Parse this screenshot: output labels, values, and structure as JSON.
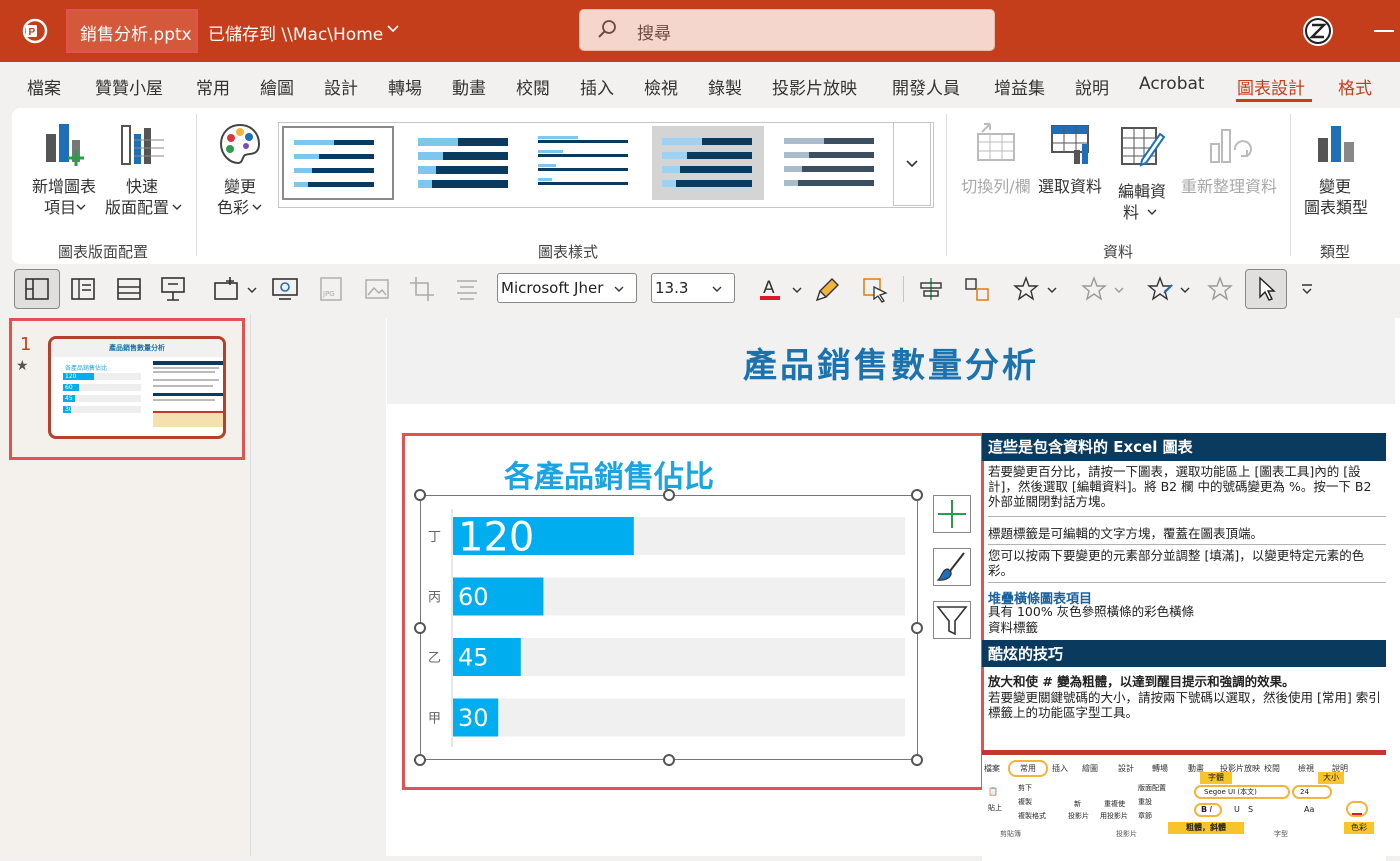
{
  "titlebar": {
    "filename": "銷售分析.pptx",
    "save_status": "已儲存到 \\\\Mac\\Home",
    "search_placeholder": "搜尋"
  },
  "tabs": [
    "檔案",
    "贊贊小屋",
    "常用",
    "繪圖",
    "設計",
    "轉場",
    "動畫",
    "校閱",
    "插入",
    "檢視",
    "錄製",
    "投影片放映",
    "開發人員",
    "增益集",
    "說明",
    "Acrobat",
    "圖表設計",
    "格式"
  ],
  "active_tab": "圖表設計",
  "ribbon": {
    "add_element_1": "新增圖表",
    "add_element_2": "項目",
    "quick_layout_1": "快速",
    "quick_layout_2": "版面配置",
    "group_layouts": "圖表版面配置",
    "change_colors_1": "變更",
    "change_colors_2": "色彩",
    "group_styles": "圖表樣式",
    "switch_row_col": "切換列/欄",
    "select_data": "選取資料",
    "edit_data_1": "編輯資",
    "edit_data_2": "料",
    "refresh_data": "重新整理資料",
    "group_data": "資料",
    "change_type_1": "變更",
    "change_type_2": "圖表類型",
    "group_type": "類型"
  },
  "toolbar": {
    "font_name": "Microsoft Jher",
    "font_size": "13.3"
  },
  "thumbnails": {
    "slide_number": "1",
    "star": "★",
    "title": "產品銷售數量分析",
    "chart_title": "各產品銷售佔比"
  },
  "slide": {
    "title": "產品銷售數量分析",
    "info_header_1": "這些是包含資料的 Excel 圖表",
    "info_p1": "若要變更百分比，請按一下圖表，選取功能區上 [圖表工具]內的 [設計]，然後選取 [編輯資料]。將 B2 欄 中的號碼變更為 %。按一下 B2 外部並關閉對話方塊。",
    "info_p2": "標題標籤是可編輯的文字方塊，覆蓋在圖表頂端。",
    "info_p3": "您可以按兩下要變更的元素部分並調整 [填滿]，以變更特定元素的色彩。",
    "info_sub": "堆疊橫條圖表項目",
    "info_p4a": "具有 100% 灰色參照橫條的彩色橫條",
    "info_p4b": "資料標籤",
    "info_header_2": "酷炫的技巧",
    "info_p5": "放大和使 # 變為粗體，以達到醒目提示和強調的效果。",
    "info_p6": "若要變更關鍵號碼的大小，請按兩下號碼以選取，然後使用 [常用] 索引標籤上的功能區字型工具。",
    "embed": {
      "tabs": [
        "檔案",
        "常用",
        "插入",
        "繪圖",
        "設計",
        "轉場",
        "動畫",
        "投影片放映",
        "校閱",
        "檢視",
        "說明"
      ],
      "font_label": "字體",
      "size_label": "大小",
      "font_name": "Segoe UI (本文)",
      "font_size": "24",
      "paste": "貼上",
      "cut": "剪下",
      "copy": "複製",
      "format_painter": "複製格式",
      "clipboard": "剪貼簿",
      "new_slide_1": "新",
      "new_slide_2": "投影片",
      "reuse_1": "重複使",
      "reuse_2": "用投影片",
      "layout": "版面配置",
      "reset": "重設",
      "section": "章節",
      "slides_group": "投影片",
      "bold_italic": "粗體，斜體",
      "font_group": "字型",
      "color": "色彩",
      "bold": "B",
      "italic": "I",
      "underline": "U",
      "strike": "S",
      "aa": "Aa"
    }
  },
  "chart_data": {
    "type": "bar",
    "title": "各產品銷售佔比",
    "categories": [
      "丁",
      "丙",
      "乙",
      "甲"
    ],
    "values": [
      120,
      60,
      45,
      30
    ],
    "reference_max": 300,
    "bar_color": "#00aeef",
    "reference_color": "#f0f0f0"
  },
  "colors": {
    "accent": "#c43e1c",
    "title_blue": "#1b72ad",
    "chart_blue": "#00aeef",
    "header_navy": "#0b3a5f"
  }
}
